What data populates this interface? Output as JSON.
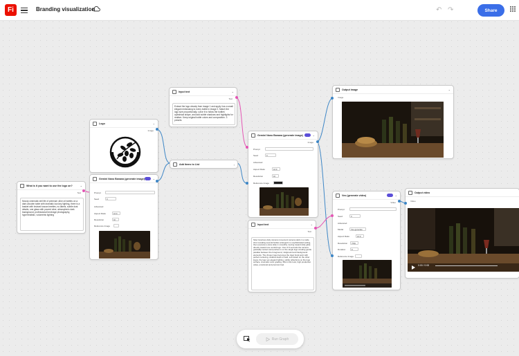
{
  "app": {
    "logo_text": "Fi",
    "title": "Branding visualization",
    "share_label": "Share"
  },
  "nodes": {
    "input_text_top": {
      "title": "Input text",
      "port_out": "Text",
      "text": "Extract the logo cleanly from image 1 and apply it as a small elegant embossing to every bottle in image 2. Match the logo size proportionally, curve it to follow the bottles' cylindrical shape, and add subtle shadows and highlights for realism. Keep original bottle colors and composition. 3 presets"
    },
    "logo": {
      "title": "Logo",
      "port_out": "Image"
    },
    "question": {
      "title": "What is it you want to use the logo on?",
      "port_out": "Text",
      "text": "Moody cinematic still life of premium olive oil bottles on a dark wooden table with dramatic low-key lighting, there is a basket with bruised tuscan beetles, no labels, subtle dust details, one glass with poured olive, atmospheric dark background, professional beverage photography, hyperrealistic, volumetric lighting"
    },
    "gemini_left": {
      "title": "Gemini Nano Banana (generate image)",
      "prompt_label": "Prompt",
      "seed_label": "Seed",
      "seed_value": "0",
      "advanced_label": "Advanced",
      "aspect_label": "Aspect Ratio",
      "aspect_value": "16:9",
      "resolution_label": "Resolution",
      "resolution_value": "1K",
      "ref_label": "Reference Image"
    },
    "add_list": {
      "title": "Add items to List"
    },
    "gemini_mid": {
      "title": "Gemini Nano Banana (generate image)",
      "port_out": "Image",
      "prompt_label": "Prompt",
      "seed_label": "Seed",
      "seed_value": "0",
      "advanced_label": "Advanced",
      "aspect_label": "Aspect Ratio",
      "aspect_value": "16:9",
      "resolution_label": "Resolution",
      "resolution_value": "1K",
      "ref_label": "Reference Image"
    },
    "output_image": {
      "title": "Output image",
      "port_in": "Image"
    },
    "input_text_bottom": {
      "title": "Input text",
      "port_out": "Text",
      "text": "Slow luxurious dolly camera movement camera starts in a wide shot revealing several bottles arranged in a sophisticated setting, then executes a slow dolly in smoothly moving toward dolly glide directly toward one central logo. Over 4-5 seconds the camera gradually centers and pushes in on the single logo creating gentle parallax between the foreground, midground and background elements. The chosen logo becomes the clear focal point with perfect centering, shallow depth of field, soft bokeh on the other logos, the logo yet elegant lighting, subtle reflections on the logo surface, cinematic color grading, 35mm film look, high production value, emotional and premium feel."
    },
    "veo": {
      "title": "Veo (generate video)",
      "port_out": "Video",
      "prompt_label": "Prompt",
      "seed_label": "Seed",
      "seed_value": "0",
      "advanced_label": "Advanced",
      "model_label": "Model",
      "model_value": "Veo-generate",
      "aspect_label": "Aspect Ratio",
      "aspect_value": "16:9",
      "resolution_label": "Resolution",
      "resolution_value": "720p",
      "duration_label": "Duration",
      "duration_value": "8",
      "ref_label": "Reference Image"
    },
    "output_video": {
      "title": "Output video",
      "port_in": "Video",
      "timecode": "0:00 / 0:08"
    }
  },
  "dock": {
    "run_label": "Run Graph"
  },
  "colors": {
    "accent": "#3a6ee8",
    "brand": "#eb1000",
    "wire_text": "#e455b4",
    "wire_image": "#3d86c6",
    "toggle": "#5b4ed8"
  }
}
